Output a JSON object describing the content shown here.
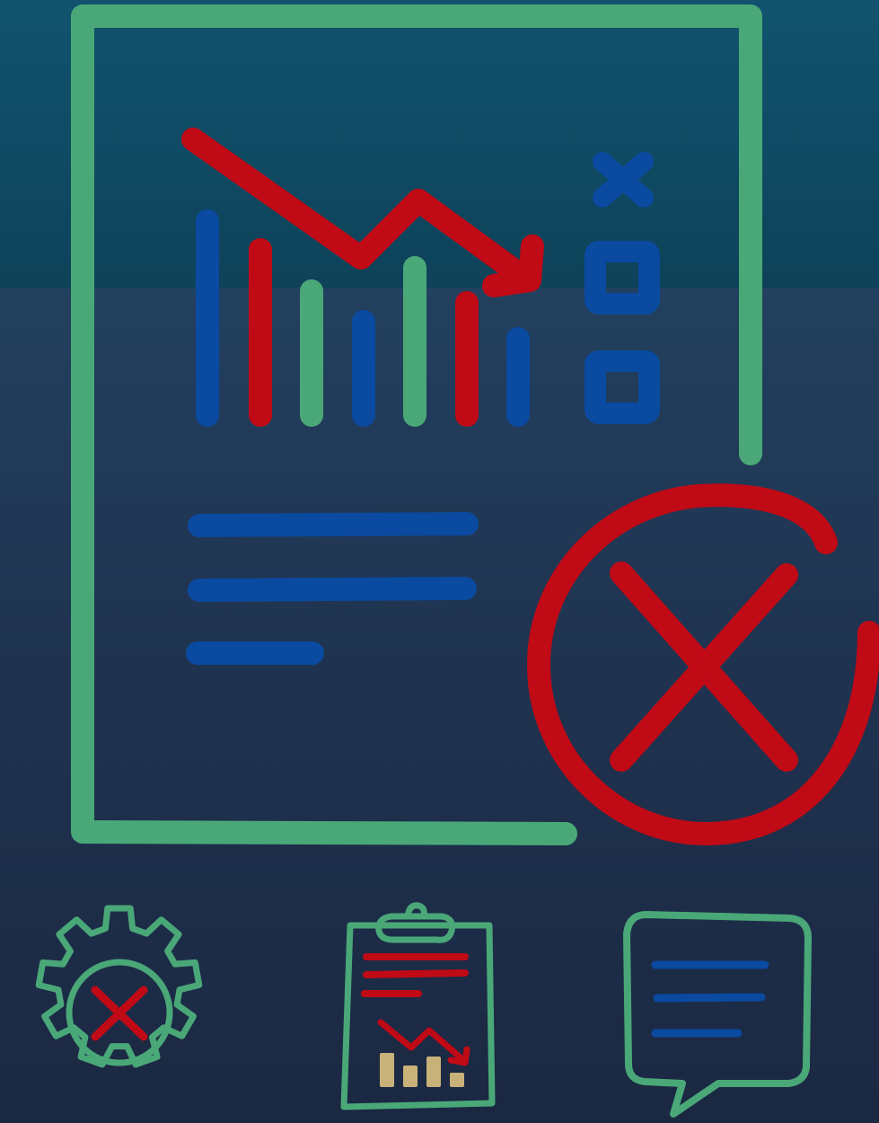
{
  "illustration": {
    "subject": "",
    "colors": {
      "background_top": "#11536e",
      "background_bottom": "#1b2842",
      "frame_green": "#4aa878",
      "accent_red": "#c00a16",
      "accent_blue": "#0a4aa0",
      "bar_gold": "#c9b27a"
    }
  },
  "icons": [
    "report-document-icon",
    "declining-trend-icon",
    "rejected-circle-x-icon",
    "gear-error-icon",
    "clipboard-report-icon",
    "speech-bubble-icon"
  ]
}
